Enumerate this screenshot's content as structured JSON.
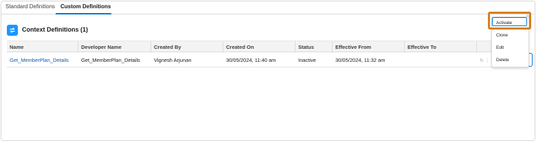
{
  "tabs": [
    {
      "label": "Standard Definitions",
      "active": false
    },
    {
      "label": "Custom Definitions",
      "active": true
    }
  ],
  "card": {
    "title": "Context Definitions (1)",
    "icon": "context-definitions-icon",
    "icon_color": "#1b96ff"
  },
  "table": {
    "columns": [
      "Name",
      "Developer Name",
      "Created By",
      "Created On",
      "Status",
      "Effective From",
      "Effective To"
    ],
    "rows": [
      {
        "name": "Get_MemberPlan_Details",
        "developer_name": "Get_MemberPlan_Details",
        "created_by": "Vignesh Arjunan",
        "created_on": "30/05/2024, 11:40 am",
        "status": "Inactive",
        "effective_from": "30/05/2024, 11:32 am",
        "effective_to": ""
      }
    ]
  },
  "row_actions_menu": {
    "items": [
      "Activate",
      "Clone",
      "Edit",
      "Delete"
    ],
    "focused_item": "Activate",
    "highlight_color": "#d87f1f"
  },
  "colors": {
    "accent": "#0176d3",
    "link": "#0b5cab"
  }
}
